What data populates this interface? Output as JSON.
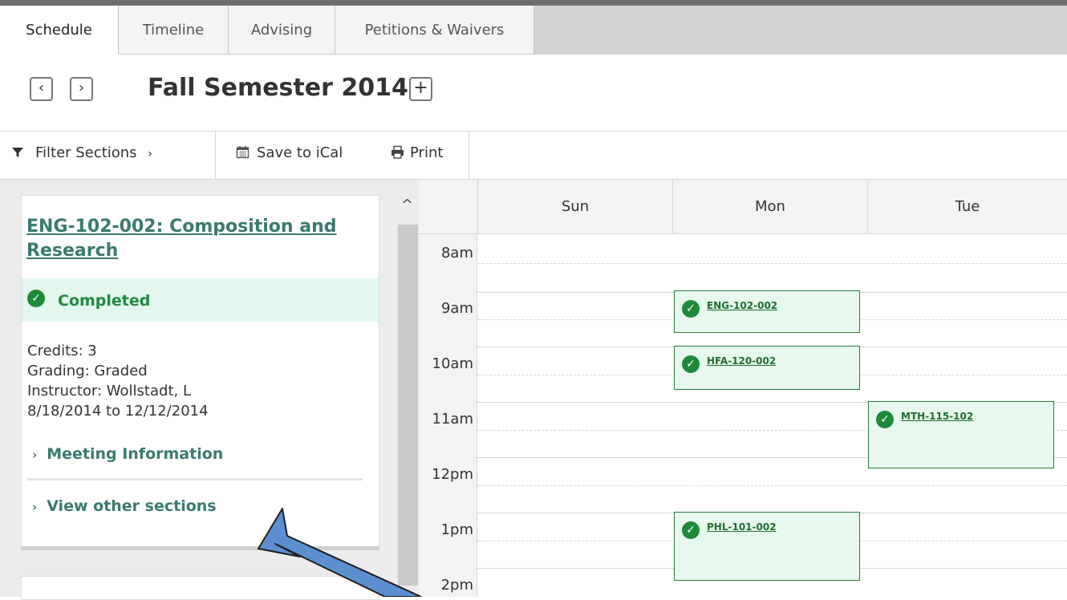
{
  "tabs": [
    {
      "label": "Schedule"
    },
    {
      "label": "Timeline"
    },
    {
      "label": "Advising"
    },
    {
      "label": "Petitions & Waivers"
    }
  ],
  "term": {
    "title": "Fall Semester 2014",
    "prev_icon": "chevron-left-icon",
    "next_icon": "chevron-right-icon",
    "add_icon": "plus-icon"
  },
  "toolbar": {
    "filter_label": "Filter Sections",
    "filter_icon": "filter-icon",
    "filter_chevron": "›",
    "ical_label": "Save to iCal",
    "ical_icon": "calendar-icon",
    "print_label": "Print",
    "print_icon": "printer-icon"
  },
  "course_card": {
    "title": "ENG-102-002: Composition and Research",
    "status": "Completed",
    "credits": "Credits: 3",
    "grading": "Grading: Graded",
    "instructor": "Instructor: Wollstadt, L",
    "dates": "8/18/2014 to 12/12/2014",
    "meeting_info": "Meeting Information",
    "other_sections": "View other sections"
  },
  "calendar": {
    "days": [
      "Sun",
      "Mon",
      "Tue"
    ],
    "times": [
      "8am",
      "9am",
      "10am",
      "11am",
      "12pm",
      "1pm",
      "2pm"
    ],
    "events": [
      {
        "label": "ENG-102-002",
        "day": "Mon",
        "start": "9am"
      },
      {
        "label": "HFA-120-002",
        "day": "Mon",
        "start": "10am"
      },
      {
        "label": "MTH-115-102",
        "day": "Tue",
        "start": "11am"
      },
      {
        "label": "PHL-101-002",
        "day": "Mon",
        "start": "1pm"
      }
    ]
  },
  "colors": {
    "accent_link": "#3a7a70",
    "completed_green": "#1e8a3a",
    "event_fill": "#e7f8ee",
    "annotation_arrow": "#5b8fd0"
  }
}
